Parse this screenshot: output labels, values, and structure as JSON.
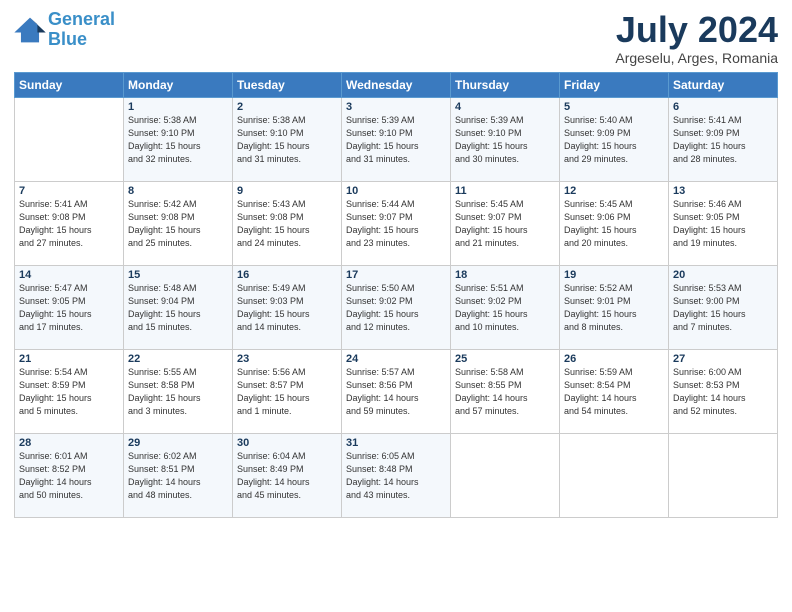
{
  "header": {
    "logo_line1": "General",
    "logo_line2": "Blue",
    "month_year": "July 2024",
    "location": "Argeselu, Arges, Romania"
  },
  "weekdays": [
    "Sunday",
    "Monday",
    "Tuesday",
    "Wednesday",
    "Thursday",
    "Friday",
    "Saturday"
  ],
  "weeks": [
    [
      {
        "day": "",
        "info": ""
      },
      {
        "day": "1",
        "info": "Sunrise: 5:38 AM\nSunset: 9:10 PM\nDaylight: 15 hours\nand 32 minutes."
      },
      {
        "day": "2",
        "info": "Sunrise: 5:38 AM\nSunset: 9:10 PM\nDaylight: 15 hours\nand 31 minutes."
      },
      {
        "day": "3",
        "info": "Sunrise: 5:39 AM\nSunset: 9:10 PM\nDaylight: 15 hours\nand 31 minutes."
      },
      {
        "day": "4",
        "info": "Sunrise: 5:39 AM\nSunset: 9:10 PM\nDaylight: 15 hours\nand 30 minutes."
      },
      {
        "day": "5",
        "info": "Sunrise: 5:40 AM\nSunset: 9:09 PM\nDaylight: 15 hours\nand 29 minutes."
      },
      {
        "day": "6",
        "info": "Sunrise: 5:41 AM\nSunset: 9:09 PM\nDaylight: 15 hours\nand 28 minutes."
      }
    ],
    [
      {
        "day": "7",
        "info": "Sunrise: 5:41 AM\nSunset: 9:08 PM\nDaylight: 15 hours\nand 27 minutes."
      },
      {
        "day": "8",
        "info": "Sunrise: 5:42 AM\nSunset: 9:08 PM\nDaylight: 15 hours\nand 25 minutes."
      },
      {
        "day": "9",
        "info": "Sunrise: 5:43 AM\nSunset: 9:08 PM\nDaylight: 15 hours\nand 24 minutes."
      },
      {
        "day": "10",
        "info": "Sunrise: 5:44 AM\nSunset: 9:07 PM\nDaylight: 15 hours\nand 23 minutes."
      },
      {
        "day": "11",
        "info": "Sunrise: 5:45 AM\nSunset: 9:07 PM\nDaylight: 15 hours\nand 21 minutes."
      },
      {
        "day": "12",
        "info": "Sunrise: 5:45 AM\nSunset: 9:06 PM\nDaylight: 15 hours\nand 20 minutes."
      },
      {
        "day": "13",
        "info": "Sunrise: 5:46 AM\nSunset: 9:05 PM\nDaylight: 15 hours\nand 19 minutes."
      }
    ],
    [
      {
        "day": "14",
        "info": "Sunrise: 5:47 AM\nSunset: 9:05 PM\nDaylight: 15 hours\nand 17 minutes."
      },
      {
        "day": "15",
        "info": "Sunrise: 5:48 AM\nSunset: 9:04 PM\nDaylight: 15 hours\nand 15 minutes."
      },
      {
        "day": "16",
        "info": "Sunrise: 5:49 AM\nSunset: 9:03 PM\nDaylight: 15 hours\nand 14 minutes."
      },
      {
        "day": "17",
        "info": "Sunrise: 5:50 AM\nSunset: 9:02 PM\nDaylight: 15 hours\nand 12 minutes."
      },
      {
        "day": "18",
        "info": "Sunrise: 5:51 AM\nSunset: 9:02 PM\nDaylight: 15 hours\nand 10 minutes."
      },
      {
        "day": "19",
        "info": "Sunrise: 5:52 AM\nSunset: 9:01 PM\nDaylight: 15 hours\nand 8 minutes."
      },
      {
        "day": "20",
        "info": "Sunrise: 5:53 AM\nSunset: 9:00 PM\nDaylight: 15 hours\nand 7 minutes."
      }
    ],
    [
      {
        "day": "21",
        "info": "Sunrise: 5:54 AM\nSunset: 8:59 PM\nDaylight: 15 hours\nand 5 minutes."
      },
      {
        "day": "22",
        "info": "Sunrise: 5:55 AM\nSunset: 8:58 PM\nDaylight: 15 hours\nand 3 minutes."
      },
      {
        "day": "23",
        "info": "Sunrise: 5:56 AM\nSunset: 8:57 PM\nDaylight: 15 hours\nand 1 minute."
      },
      {
        "day": "24",
        "info": "Sunrise: 5:57 AM\nSunset: 8:56 PM\nDaylight: 14 hours\nand 59 minutes."
      },
      {
        "day": "25",
        "info": "Sunrise: 5:58 AM\nSunset: 8:55 PM\nDaylight: 14 hours\nand 57 minutes."
      },
      {
        "day": "26",
        "info": "Sunrise: 5:59 AM\nSunset: 8:54 PM\nDaylight: 14 hours\nand 54 minutes."
      },
      {
        "day": "27",
        "info": "Sunrise: 6:00 AM\nSunset: 8:53 PM\nDaylight: 14 hours\nand 52 minutes."
      }
    ],
    [
      {
        "day": "28",
        "info": "Sunrise: 6:01 AM\nSunset: 8:52 PM\nDaylight: 14 hours\nand 50 minutes."
      },
      {
        "day": "29",
        "info": "Sunrise: 6:02 AM\nSunset: 8:51 PM\nDaylight: 14 hours\nand 48 minutes."
      },
      {
        "day": "30",
        "info": "Sunrise: 6:04 AM\nSunset: 8:49 PM\nDaylight: 14 hours\nand 45 minutes."
      },
      {
        "day": "31",
        "info": "Sunrise: 6:05 AM\nSunset: 8:48 PM\nDaylight: 14 hours\nand 43 minutes."
      },
      {
        "day": "",
        "info": ""
      },
      {
        "day": "",
        "info": ""
      },
      {
        "day": "",
        "info": ""
      }
    ]
  ]
}
